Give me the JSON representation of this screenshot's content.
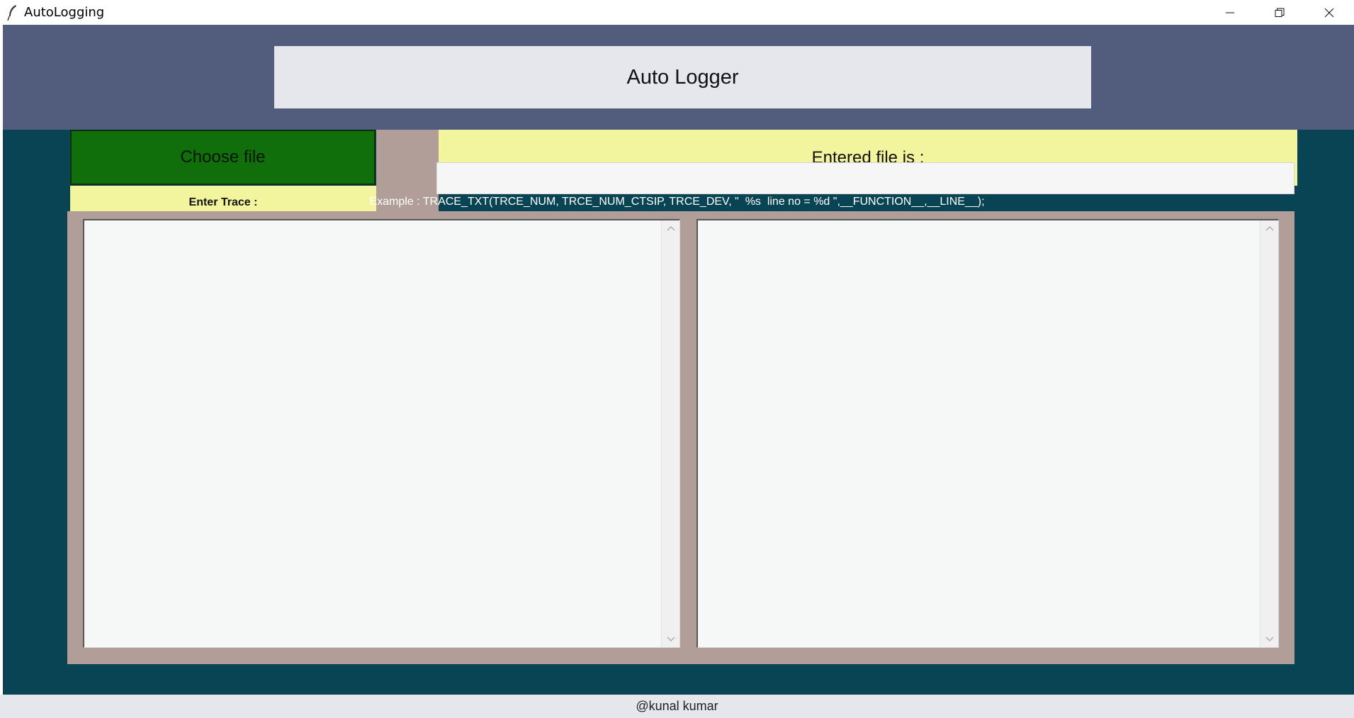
{
  "window": {
    "title": "AutoLogging",
    "icon": "feather-icon",
    "controls": [
      "minimize-icon",
      "restore-icon",
      "close-icon"
    ]
  },
  "header": {
    "title": "Auto Logger"
  },
  "controls": {
    "choose_file_label": "Choose file",
    "entered_file_label": "Entered file is :",
    "trace_label": "Enter Trace :",
    "trace_value": "",
    "example_text": "Example : TRACE_TXT(TRCE_NUM, TRCE_NUM_CTSIP, TRCE_DEV, \"  %s  line no = %d \",__FUNCTION__,__LINE__);"
  },
  "panels": {
    "left_text": "",
    "right_text": ""
  },
  "footer": {
    "credit": "@kunal kumar"
  },
  "colors": {
    "header_band": "#525c7c",
    "body_background": "#094454",
    "choose_button": "#106e0b",
    "yellow_labels": "#f2f59e",
    "panel_frame": "#b19e99"
  }
}
